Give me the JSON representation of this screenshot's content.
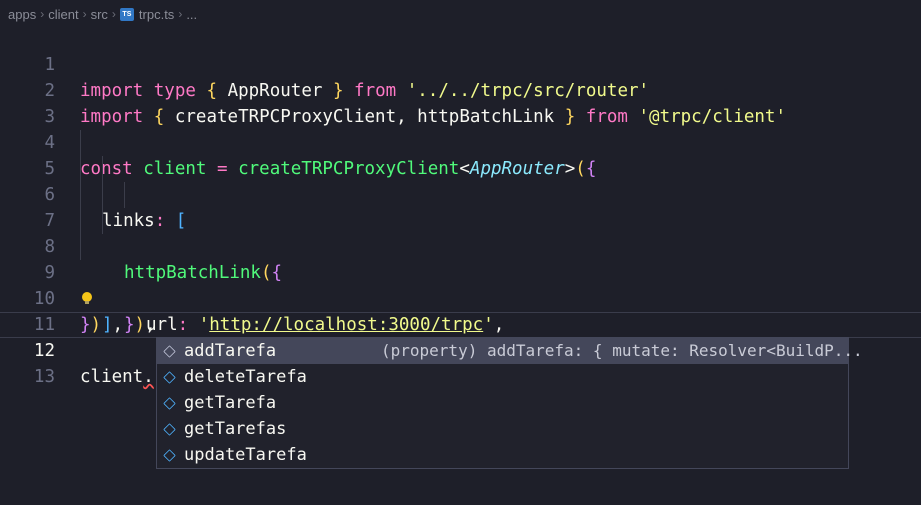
{
  "breadcrumb": {
    "items": [
      "apps",
      "client",
      "src"
    ],
    "file_badge": "TS",
    "file": "trpc.ts",
    "more": "..."
  },
  "editor": {
    "line_numbers": [
      "1",
      "2",
      "3",
      "4",
      "5",
      "6",
      "7",
      "8",
      "9",
      "10",
      "11",
      "12",
      "13"
    ],
    "current_line": 12,
    "l1": {
      "t1": "import",
      "t2": "type",
      "t3": "{",
      "t4": "AppRouter",
      "t5": "}",
      "t6": "from",
      "t7": "'../../trpc/src/router'"
    },
    "l2": {
      "t1": "import",
      "t2": "{",
      "t3": "createTRPCProxyClient, httpBatchLink",
      "t4": "}",
      "t5": "from",
      "t6": "'@trpc/client'"
    },
    "l4": {
      "t1": "const",
      "t2": "client",
      "t3": "=",
      "t4": "createTRPCProxyClient",
      "t5": "<",
      "t6": "AppRouter",
      "t7": ">",
      "t8": "(",
      "t9": "{"
    },
    "l5": {
      "t1": "links",
      "t2": ":",
      "t3": "["
    },
    "l6": {
      "t1": "httpBatchLink",
      "t2": "(",
      "t3": "{"
    },
    "l7": {
      "t1": "url",
      "t2": ":",
      "t3": "'",
      "t4": "http://localhost:3000/trpc",
      "t5": "'",
      "t6": ","
    },
    "l8": {
      "t1": "}",
      "t2": ")",
      "t3": ","
    },
    "l9": {
      "t1": "]",
      "t2": ","
    },
    "l10": {
      "t1": "}",
      "t2": ")"
    },
    "l12": {
      "t1": "client",
      "t2": "."
    }
  },
  "suggestions": {
    "items": [
      {
        "label": "addTarefa",
        "detail": "(property) addTarefa: { mutate: Resolver<BuildP..."
      },
      {
        "label": "deleteTarefa"
      },
      {
        "label": "getTarefa"
      },
      {
        "label": "getTarefas"
      },
      {
        "label": "updateTarefa"
      }
    ],
    "selected_index": 0,
    "icon": "cube-icon"
  },
  "colors": {
    "background": "#1e1f29",
    "keyword": "#ff79c6",
    "string": "#f1fa8c",
    "function": "#50fa7b",
    "type": "#8be9fd"
  }
}
